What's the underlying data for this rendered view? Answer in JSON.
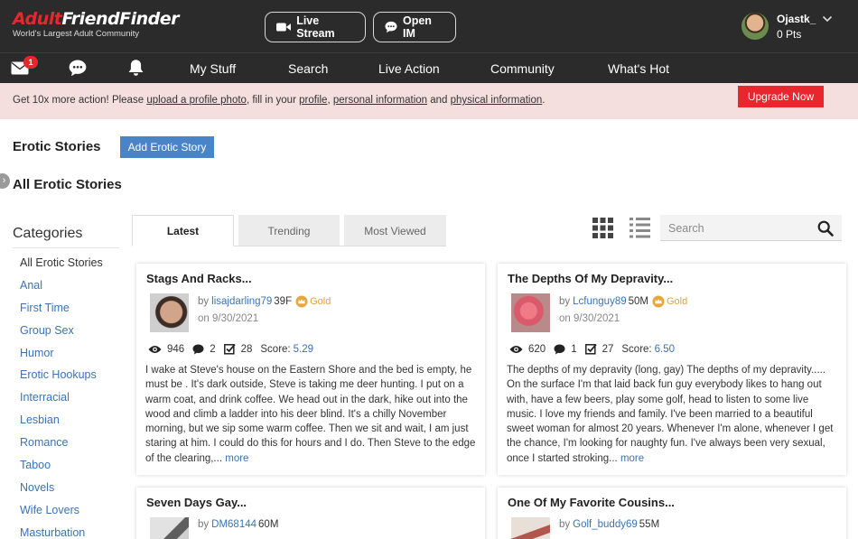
{
  "brand": {
    "logo_part1": "Adult",
    "logo_part2": "FriendFinder",
    "tagline": "World's Largest Adult Community"
  },
  "header": {
    "live_stream": "Live Stream",
    "open_im": "Open IM"
  },
  "user": {
    "name": "Ojastk_",
    "points": "0 Pts"
  },
  "nav": {
    "mail_badge": "1",
    "links": [
      "My Stuff",
      "Search",
      "Live Action",
      "Community",
      "What's Hot"
    ]
  },
  "notice": {
    "prefix": "Get 10x more action! Please",
    "link_photo": "upload a profile photo",
    "mid1": ", fill in your",
    "link_profile": "profile",
    "comma": ",",
    "link_personal": "personal information",
    "and": "and",
    "link_physical": "physical information",
    "suffix": ".",
    "upgrade": "Upgrade Now"
  },
  "page": {
    "title": "Erotic Stories",
    "add_button": "Add Erotic Story",
    "subtitle": "All Erotic Stories"
  },
  "categories": {
    "heading": "Categories",
    "items": [
      "All Erotic Stories",
      "Anal",
      "First Time",
      "Group Sex",
      "Humor",
      "Erotic Hookups",
      "Interracial",
      "Lesbian",
      "Romance",
      "Taboo",
      "Novels",
      "Wife Lovers",
      "Masturbation"
    ]
  },
  "tabs": [
    "Latest",
    "Trending",
    "Most Viewed"
  ],
  "search": {
    "placeholder": "Search"
  },
  "stories": [
    {
      "title": "Stags And Racks...",
      "by": "by",
      "author": "lisajdarling79",
      "age": "39F",
      "badge": "Gold",
      "date": "on 9/30/2021",
      "views": "946",
      "comments": "2",
      "checks": "28",
      "score_label": "Score:",
      "score": "5.29",
      "excerpt": "I wake at Steve's house on the Eastern Shore and the bed is empty, he must be . It's dark outside, Steve is taking me deer hunting. I put on a warm coat, and drink coffee. We head out in the dark, hike out into the wood and climb a ladder into his deer blind. It's a chilly November morning, but we sip some warm coffee. Then we sit and wait, I am just staring at him. I could do this for hours and I do. Then Steve to the edge of the clearing,...",
      "more": "more"
    },
    {
      "title": "The Depths Of My Depravity...",
      "by": "by",
      "author": "Lcfunguy89",
      "age": "50M",
      "badge": "Gold",
      "date": "on 9/30/2021",
      "views": "620",
      "comments": "1",
      "checks": "27",
      "score_label": "Score:",
      "score": "6.50",
      "excerpt": "The depths of my depravity (long, gay) The depths of my depravity..... On the surface I'm that laid back fun guy everybody likes to hang out with, have a few beers, play some golf, head to listen to some live music. I love my friends and family. I've been married to a beautiful sweet woman for almost 20 years. Whenever I'm alone, whenever I get the chance, I'm looking for naughty fun. I've always been very sexual, once I started stroking...",
      "more": "more"
    },
    {
      "title": "Seven Days Gay...",
      "by": "by",
      "author": "DM68144",
      "age": "60M"
    },
    {
      "title": "One Of My Favorite Cousins...",
      "by": "by",
      "author": "Golf_buddy69",
      "age": "55M"
    }
  ]
}
